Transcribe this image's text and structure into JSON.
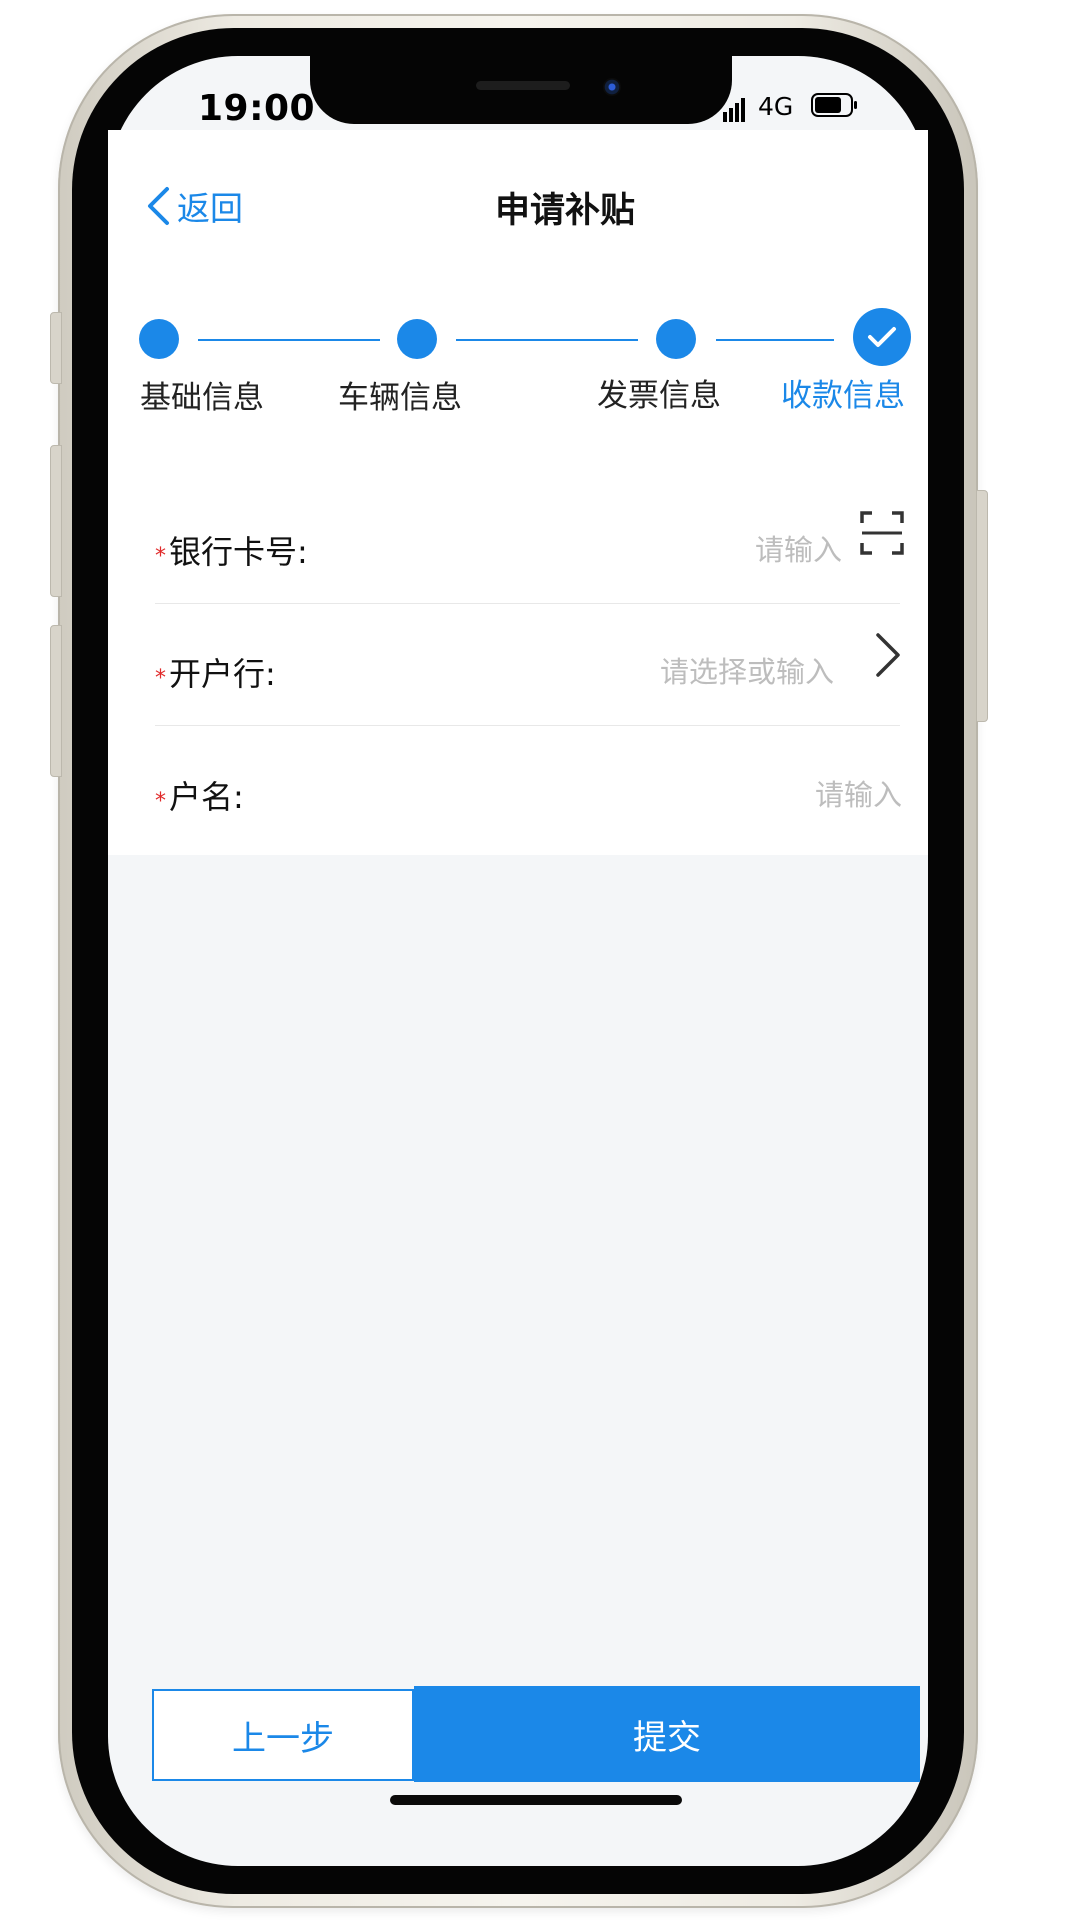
{
  "status_bar": {
    "time": "19:00",
    "network": "4G"
  },
  "nav": {
    "back_label": "返回",
    "title": "申请补贴"
  },
  "steps": [
    {
      "label": "基础信息",
      "state": "done"
    },
    {
      "label": "车辆信息",
      "state": "done"
    },
    {
      "label": "发票信息",
      "state": "done"
    },
    {
      "label": "收款信息",
      "state": "active"
    }
  ],
  "form": {
    "required_mark": "*",
    "bank_card": {
      "label": "银行卡号:",
      "placeholder": "请输入",
      "icon": "scan-icon"
    },
    "bank_branch": {
      "label": "开户行:",
      "placeholder": "请选择或输入",
      "icon": "chevron-right-icon"
    },
    "account_name": {
      "label": "户名:",
      "placeholder": "请输入"
    }
  },
  "actions": {
    "prev_label": "上一步",
    "submit_label": "提交"
  },
  "colors": {
    "accent": "#1b88e8",
    "required": "#e02a2a",
    "placeholder": "#bdbdbd",
    "background": "#f4f6f8"
  }
}
